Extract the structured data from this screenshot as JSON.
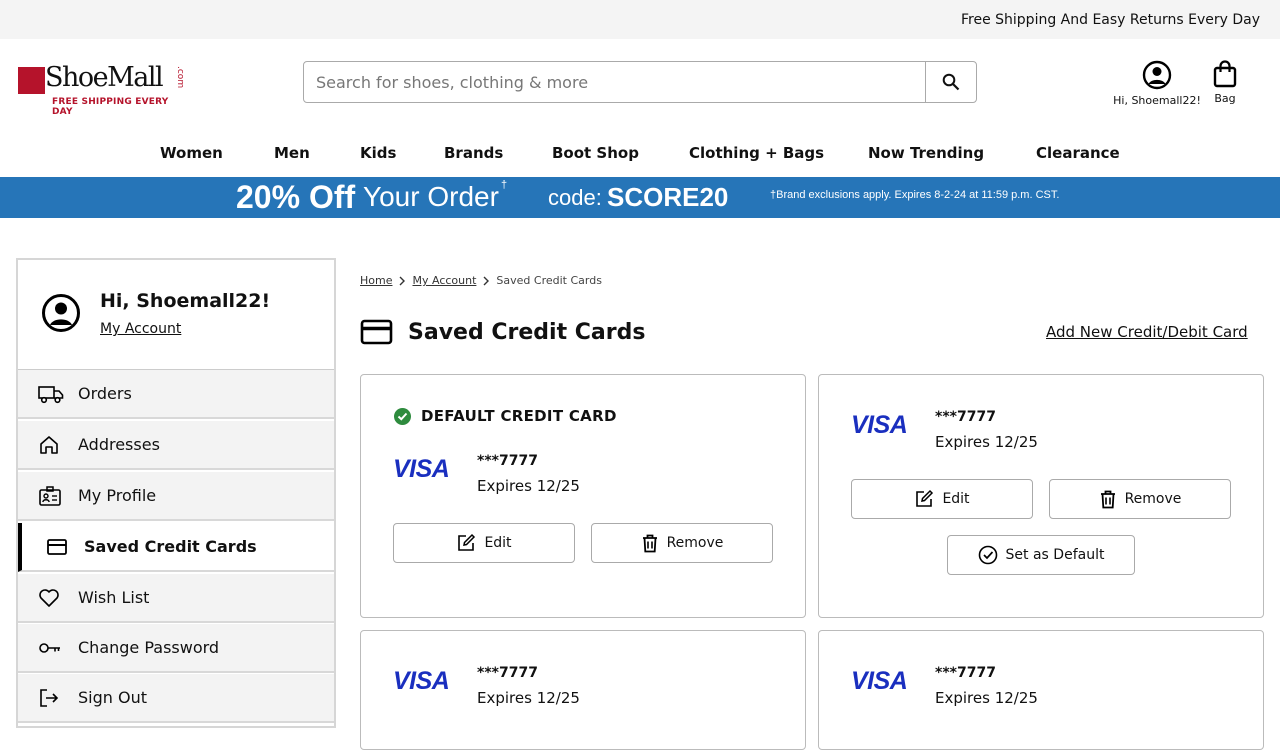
{
  "topbar": {
    "message": "Free Shipping And Easy Returns Every Day"
  },
  "logo": {
    "name": "ShoeMall",
    "suffix": ".com",
    "tagline": "FREE SHIPPING EVERY DAY"
  },
  "search": {
    "placeholder": "Search for shoes, clothing & more",
    "value": ""
  },
  "header": {
    "account_label": "Hi, Shoemall22!",
    "bag_label": "Bag"
  },
  "nav": {
    "items": [
      "Women",
      "Men",
      "Kids",
      "Brands",
      "Boot Shop",
      "Clothing + Bags",
      "Now Trending",
      "Clearance"
    ]
  },
  "promo": {
    "discount": "20% Off",
    "text": "Your Order",
    "dagger": "†",
    "code_label": "code:",
    "code": "SCORE20",
    "disclaimer": "†Brand exclusions apply. Expires 8-2-24 at 11:59 p.m. CST."
  },
  "sidebar": {
    "greeting": "Hi, Shoemall22!",
    "account_link": "My Account",
    "items": [
      {
        "label": "Orders",
        "icon": "truck-icon"
      },
      {
        "label": "Addresses",
        "icon": "home-icon"
      },
      {
        "label": "My Profile",
        "icon": "id-card-icon"
      },
      {
        "label": "Saved Credit Cards",
        "icon": "credit-card-icon",
        "active": true
      },
      {
        "label": "Wish List",
        "icon": "heart-icon"
      },
      {
        "label": "Change Password",
        "icon": "key-icon"
      },
      {
        "label": "Sign Out",
        "icon": "sign-out-icon"
      }
    ]
  },
  "breadcrumb": {
    "home": "Home",
    "account": "My Account",
    "current": "Saved Credit Cards"
  },
  "page": {
    "title": "Saved Credit Cards",
    "add_link": "Add New Credit/Debit Card"
  },
  "cards": [
    {
      "default": true,
      "default_label": "DEFAULT CREDIT CARD",
      "brand": "VISA",
      "number": "***7777",
      "expires": "Expires 12/25",
      "edit": "Edit",
      "remove": "Remove"
    },
    {
      "default": false,
      "brand": "VISA",
      "number": "***7777",
      "expires": "Expires 12/25",
      "edit": "Edit",
      "remove": "Remove",
      "set_default": "Set as Default"
    },
    {
      "brand": "VISA",
      "number": "***7777",
      "expires": "Expires 12/25"
    },
    {
      "brand": "VISA",
      "number": "***7777",
      "expires": "Expires 12/25"
    }
  ],
  "colors": {
    "brand_red": "#b5132b",
    "promo_blue": "#2675b8",
    "visa_blue": "#1a2fbf",
    "check_green": "#2e8b3e"
  }
}
